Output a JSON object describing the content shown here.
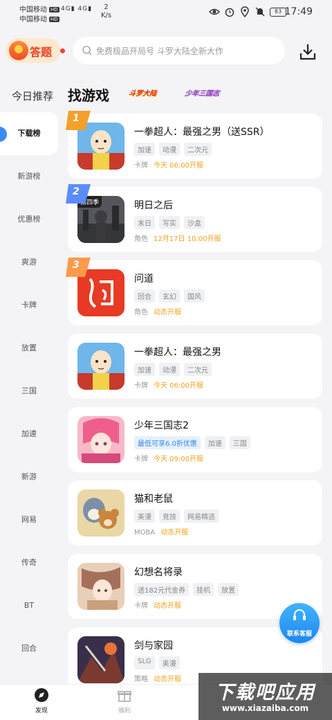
{
  "status_bar": {
    "carrier1": "中国移动",
    "carrier2": "中国移动",
    "hd": "HD",
    "signal1": "4G",
    "signal2": "4G",
    "speed_value": "2",
    "speed_unit": "K/s",
    "battery": "83",
    "time": "17:49",
    "icons": [
      "eye-icon",
      "alarm-icon",
      "location-icon",
      "bell-muted-icon",
      "battery-icon"
    ]
  },
  "header": {
    "answer_label": "答题",
    "search_placeholder": "免费极品开局号 斗罗大陆全新大作",
    "download_icon": "download-icon"
  },
  "tabs": [
    {
      "label": "今日推荐",
      "active": false
    },
    {
      "label": "找游戏",
      "active": true
    },
    {
      "label": "斗罗大陆",
      "type": "logo"
    },
    {
      "label": "少年三国志",
      "type": "logo"
    }
  ],
  "sidebar": {
    "active_index": 0,
    "items": [
      "下载榜",
      "新游榜",
      "优惠榜",
      "爽游",
      "卡牌",
      "放置",
      "三国",
      "加速",
      "新游",
      "网易",
      "传奇",
      "BT",
      "回合"
    ]
  },
  "games": [
    {
      "rank": "1",
      "title": "一拳超人：最强之男（送SSR）",
      "tags": [
        "加速",
        "动漫",
        "二次元"
      ],
      "category": "卡牌",
      "time": "今天 06:00开服",
      "icon": "onepunch"
    },
    {
      "rank": "2",
      "title": "明日之后",
      "badge": "第四季",
      "tags": [
        "末日",
        "写实",
        "沙盒"
      ],
      "category": "角色",
      "time": "12月17日 10:00开服",
      "icon": "tomorrow"
    },
    {
      "rank": "3",
      "title": "问道",
      "tags": [
        "回合",
        "玄幻",
        "国风"
      ],
      "category": "角色",
      "time": "动态开服",
      "icon": "wendao"
    },
    {
      "title": "一拳超人：最强之男",
      "tags": [
        "加速",
        "动漫",
        "二次元"
      ],
      "category": "卡牌",
      "time": "今天 06:00开服",
      "icon": "onepunch"
    },
    {
      "title": "少年三国志2",
      "tags": [
        "最低可享6.0折优惠",
        "加速",
        "三国"
      ],
      "category": "卡牌",
      "time": "今天 09:00开服",
      "icon": "sanguo",
      "promo_tag": true
    },
    {
      "title": "猫和老鼠",
      "tags": [
        "美漫",
        "竞技",
        "网易精选"
      ],
      "category": "MOBA",
      "time": "动态开服",
      "icon": "tomjerry"
    },
    {
      "title": "幻想名将录",
      "tags": [
        "送182元代金券",
        "挂机",
        "放置"
      ],
      "category": "卡牌",
      "time": "动态开服",
      "icon": "huanxiang"
    },
    {
      "title": "剑与家园",
      "tags": [
        "SLG",
        "美漫"
      ],
      "category": "策略",
      "time": "动态开服",
      "icon": "jianyu"
    }
  ],
  "fab": {
    "label": "联系客服",
    "icon": "headset-icon"
  },
  "bottom_nav": [
    {
      "label": "发现",
      "icon": "compass-icon",
      "active": true
    },
    {
      "label": "福利",
      "icon": "gift-icon",
      "active": false
    }
  ],
  "watermark": {
    "title": "下载吧应用",
    "url": "www.xiazaiba.com"
  },
  "colors": {
    "accent": "#3a8bff",
    "time_text": "#f0a21c",
    "background": "#f4f4f6",
    "rank1": "#f5a02a",
    "rank2": "#5b8cff",
    "rank3": "#ff9a4a"
  }
}
